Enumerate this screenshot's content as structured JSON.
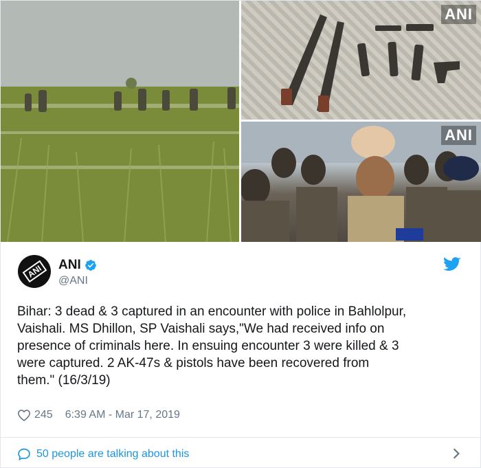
{
  "media": {
    "watermark": "ANI"
  },
  "author": {
    "display_name": "ANI",
    "handle": "@ANI",
    "avatar_text": "ANI"
  },
  "tweet": {
    "text": "Bihar: 3 dead & 3 captured in an encounter with police in Bahlolpur,\nVaishali. MS Dhillon, SP Vaishali says,\"We had received info on\npresence of criminals here. In ensuing encounter 3 were killed & 3\nwere captured. 2 AK-47s & pistols have been recovered from\nthem.\" (16/3/19)"
  },
  "meta": {
    "likes": "245",
    "timestamp": "6:39 AM - Mar 17, 2019"
  },
  "footer": {
    "talking": "50 people are talking about this"
  },
  "colors": {
    "accent": "#1da1f2",
    "link": "#1b95e0",
    "muted": "#657786",
    "verified": "#1da1f2"
  },
  "icons": {
    "verified": "verified-badge-icon",
    "twitter": "twitter-bird-icon",
    "like": "heart-icon",
    "reply": "speech-bubble-icon",
    "more": "chevron-right-icon"
  }
}
